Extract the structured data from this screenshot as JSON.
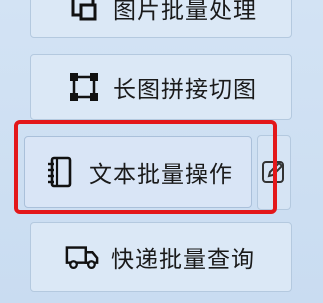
{
  "panel": {
    "buttons": [
      {
        "label": "图片批量处理",
        "icon": "image-crop-icon"
      },
      {
        "label": "长图拼接切图",
        "icon": "selection-frame-icon"
      },
      {
        "label": "文本批量操作",
        "icon": "notebook-icon",
        "selected": true
      },
      {
        "label": "快递批量查询",
        "icon": "truck-icon"
      }
    ],
    "side_edit_icon": "edit-icon",
    "highlight_color": "#e3171a"
  }
}
